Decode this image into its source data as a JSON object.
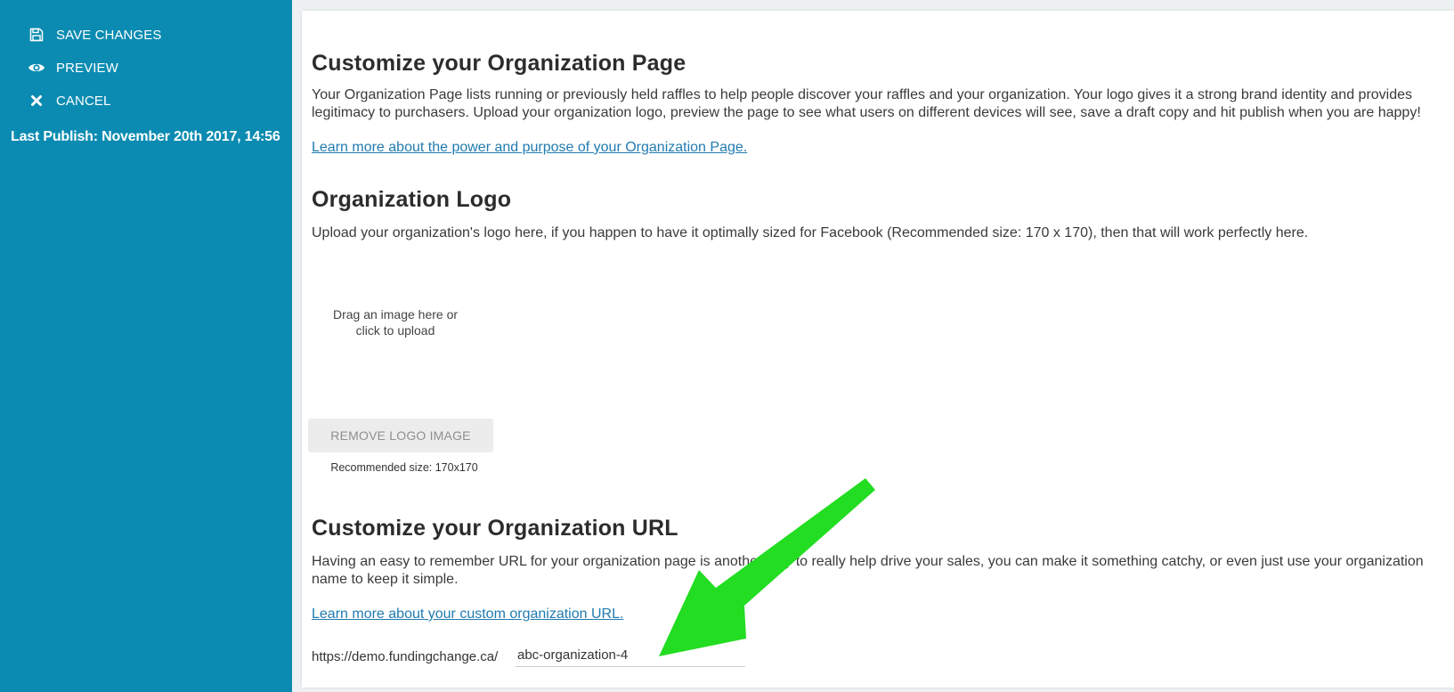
{
  "sidebar": {
    "save_label": "SAVE CHANGES",
    "preview_label": "PREVIEW",
    "cancel_label": "CANCEL",
    "last_publish_label": "Last Publish:",
    "last_publish_value": "November 20th 2017, 14:56"
  },
  "main": {
    "page_section": {
      "title": "Customize your Organization Page",
      "description": "Your Organization Page lists running or previously held raffles to help people discover your raffles and your organization. Your logo gives it a strong brand identity and provides legitimacy to purchasers. Upload your organization logo, preview the page to see what users on different devices will see, save a draft copy and hit publish when you are happy!",
      "link": "Learn more about the power and purpose of your Organization Page."
    },
    "logo_section": {
      "title": "Organization Logo",
      "description": "Upload your organization's logo here, if you happen to have it optimally sized for Facebook (Recommended size: 170 x 170), then that will work perfectly here.",
      "dropzone_text": "Drag an image here or click to upload",
      "remove_button": "REMOVE LOGO IMAGE",
      "recommended_size": "Recommended size: 170x170"
    },
    "url_section": {
      "title": "Customize your Organization URL",
      "description": "Having an easy to remember URL for your organization page is another way to really help drive your sales, you can make it something catchy, or even just use your organization name to keep it simple.",
      "link": "Learn more about your custom organization URL.",
      "url_prefix": "https://demo.fundingchange.ca/",
      "url_slug": "abc-organization-4"
    }
  },
  "colors": {
    "sidebar_bg": "#0b8bb1",
    "link": "#1f7bb0",
    "annotation_arrow": "#22dd22"
  },
  "icons": {
    "save": "floppy-disk-icon",
    "preview": "eye-icon",
    "cancel": "close-icon"
  }
}
